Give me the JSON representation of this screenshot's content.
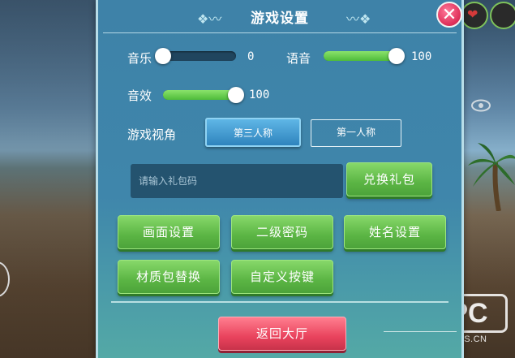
{
  "title": "游戏设置",
  "audio": {
    "music": {
      "label": "音乐",
      "value": 0,
      "value_text": "0"
    },
    "voice": {
      "label": "语音",
      "value": 100,
      "value_text": "100"
    },
    "sfx": {
      "label": "音效",
      "value": 100,
      "value_text": "100"
    }
  },
  "view": {
    "label": "游戏视角",
    "options": [
      "第三人称",
      "第一人称"
    ],
    "selected": "第三人称"
  },
  "gift": {
    "placeholder": "请输入礼包码",
    "button": "兑换礼包"
  },
  "buttons": {
    "graphics": "画面设置",
    "second_password": "二级密码",
    "name_settings": "姓名设置",
    "texture_pack": "材质包替换",
    "custom_keys": "自定义按键"
  },
  "back_button": "返回大厅",
  "watermark": {
    "logo": "PC",
    "site": "PHPCMS.CN"
  },
  "colors": {
    "panel": "#3f86ab",
    "green_button": "#5bb544",
    "red_button": "#e9435d",
    "slider_fill": "#6ccf52",
    "view_active": "#2f84bd"
  },
  "icons": {
    "close": "close-icon",
    "heart": "heart-icon",
    "eye": "eye-icon"
  }
}
